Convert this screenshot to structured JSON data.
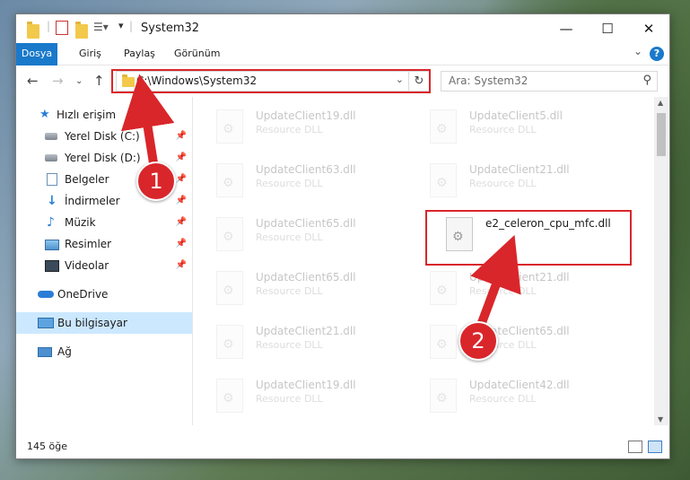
{
  "window": {
    "title": "System32",
    "ribbon_tabs": [
      "Dosya",
      "Giriş",
      "Paylaş",
      "Görünüm"
    ]
  },
  "navbar": {
    "address_path": "C:\\Windows\\System32",
    "search_placeholder": "Ara: System32"
  },
  "sidebar": {
    "items": [
      {
        "label": "Hızlı erişim",
        "icon": "star-icon",
        "pinned": false
      },
      {
        "label": "Yerel Disk (C:)",
        "icon": "drive-icon",
        "pinned": true
      },
      {
        "label": "Yerel Disk (D:)",
        "icon": "drive-icon",
        "pinned": true
      },
      {
        "label": "Belgeler",
        "icon": "document-icon",
        "pinned": true
      },
      {
        "label": "İndirmeler",
        "icon": "download-icon",
        "pinned": true
      },
      {
        "label": "Müzik",
        "icon": "music-icon",
        "pinned": true
      },
      {
        "label": "Resimler",
        "icon": "pictures-icon",
        "pinned": true
      },
      {
        "label": "Videolar",
        "icon": "video-icon",
        "pinned": true
      },
      {
        "label": "OneDrive",
        "icon": "cloud-icon",
        "pinned": false
      },
      {
        "label": "Bu bilgisayar",
        "icon": "computer-icon",
        "pinned": false,
        "selected": true
      },
      {
        "label": "Ağ",
        "icon": "network-icon",
        "pinned": false
      }
    ]
  },
  "files": {
    "left_column": [
      {
        "name": "UpdateClient19.dll",
        "type": "Resource DLL"
      },
      {
        "name": "UpdateClient63.dll",
        "type": "Resource DLL"
      },
      {
        "name": "UpdateClient65.dll",
        "type": "Resource DLL"
      },
      {
        "name": "UpdateClient65.dll",
        "type": "Resource DLL"
      },
      {
        "name": "UpdateClient21.dll",
        "type": "Resource DLL"
      },
      {
        "name": "UpdateClient19.dll",
        "type": "Resource DLL"
      }
    ],
    "right_column": [
      {
        "name": "UpdateClient5.dll",
        "type": "Resource DLL"
      },
      {
        "name": "UpdateClient21.dll",
        "type": "Resource DLL"
      },
      {
        "name": "e2_celeron_cpu_mfc.dll",
        "type": "",
        "highlighted": true
      },
      {
        "name": "UpdateClient21.dll",
        "type": "Resource DLL"
      },
      {
        "name": "UpdateClient65.dll",
        "type": "Resource DLL"
      },
      {
        "name": "UpdateClient42.dll",
        "type": "Resource DLL"
      }
    ]
  },
  "status": {
    "item_count": "145 öğe"
  },
  "annotations": {
    "step1": "1",
    "step2": "2",
    "color": "#d9262b"
  }
}
